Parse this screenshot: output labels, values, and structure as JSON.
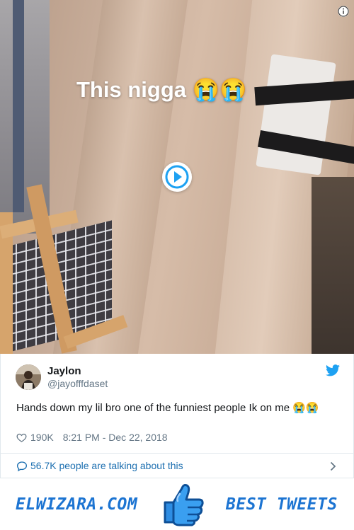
{
  "video": {
    "caption": "This nigga 😭😭",
    "play_icon": "play-icon",
    "info_icon": "info-icon"
  },
  "tweet": {
    "author_name": "Jaylon",
    "author_handle": "@jayofffdaset",
    "text": "Hands down my lil bro one of the funniest people Ik on me 😭😭",
    "likes": "190K",
    "timestamp": "8:21 PM - Dec 22, 2018",
    "brand_icon": "twitter-bird-icon"
  },
  "conversation": {
    "label": "56.7K people are talking about this"
  },
  "footer": {
    "site": "ELWIZARA.COM",
    "tagline": "BEST TWEETS",
    "mascot_icon": "thumbs-up-icon"
  },
  "colors": {
    "twitter_blue": "#1da1f2",
    "link_blue": "#1c6fb0",
    "footer_blue": "#1c74d2",
    "muted": "#657786",
    "border": "#e1e8ed"
  }
}
